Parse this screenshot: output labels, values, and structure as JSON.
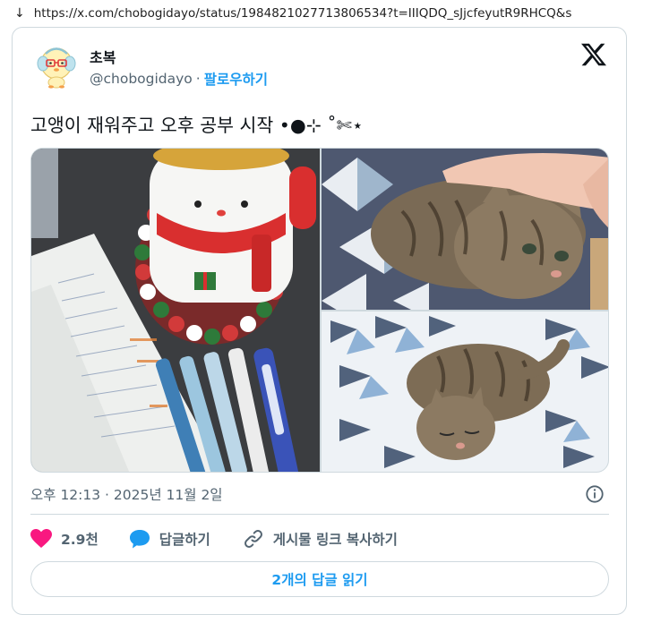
{
  "browser": {
    "download_glyph": "↓",
    "url": "https://x.com/chobogidayo/status/1984821027713806534?t=IIIQDQ_sJjcfeyutR9RHCQ&s"
  },
  "tweet": {
    "author": {
      "display_name": "초복",
      "handle": "@chobogidayo",
      "separator": "·",
      "follow_label": "팔로우하기"
    },
    "text": "고앵이 재워주고 오후 공부 시작 •●⊹ ˚✄⋆ ",
    "timestamp": "오후 12:13 · 2025년 11월 2일",
    "actions": {
      "like_count": "2.9천",
      "reply_label": "답글하기",
      "copy_link_label": "게시물 링크 복사하기"
    },
    "read_replies_label": "2개의 답글 읽기",
    "icons": [
      "x-logo-icon",
      "info-icon",
      "heart-icon",
      "reply-bubble-icon",
      "link-icon"
    ]
  },
  "colors": {
    "accent": "#1d9bf0",
    "like": "#f91880",
    "text_secondary": "#536471",
    "border": "#cfd9de"
  }
}
